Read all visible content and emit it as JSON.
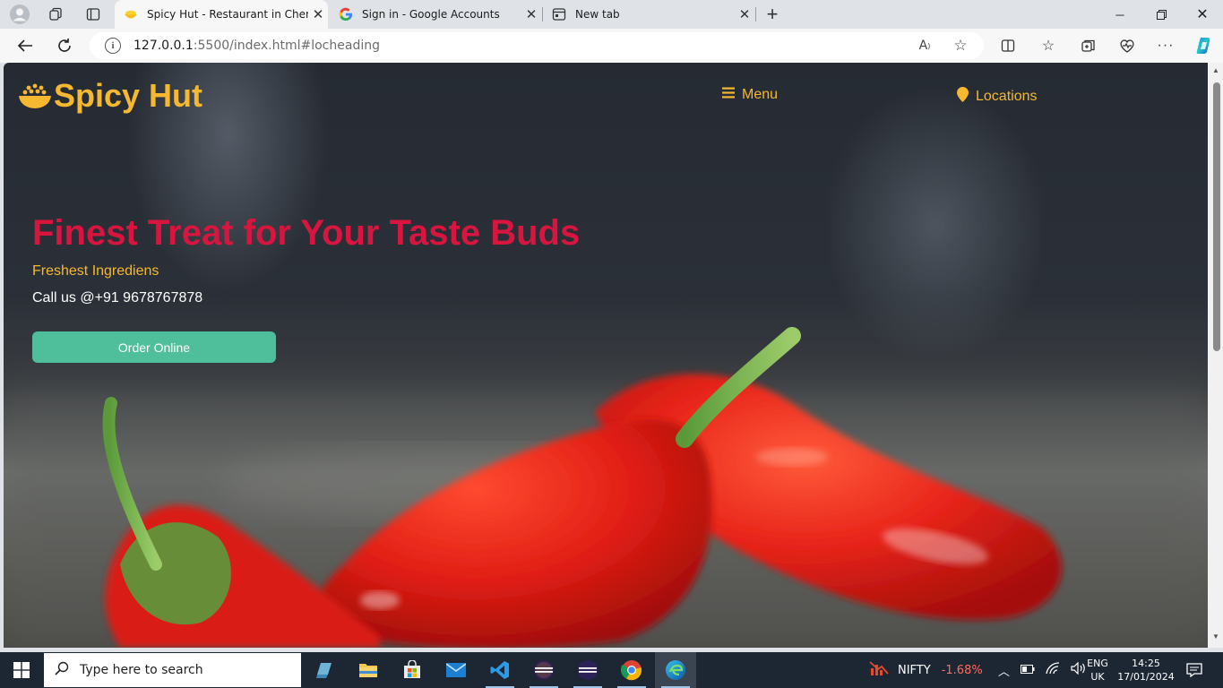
{
  "browser": {
    "tabs": [
      {
        "title": "Spicy Hut - Restaurant in Chenna",
        "icon": "rice-bowl-icon",
        "active": true
      },
      {
        "title": "Sign in - Google Accounts",
        "icon": "google-icon",
        "active": false
      },
      {
        "title": "New tab",
        "icon": "new-tab-icon",
        "active": false
      }
    ],
    "url_host": "127.0.0.1",
    "url_path": ":5500/index.html#locheading"
  },
  "site": {
    "brand": "Spicy Hut",
    "nav": {
      "menu_label": "Menu",
      "locations_label": "Locations"
    },
    "hero": {
      "headline": "Finest Treat for Your Taste Buds",
      "subtitle": "Freshest Ingrediens",
      "call": "Call us @+91 9678767878",
      "order_button": "Order Online"
    },
    "colors": {
      "brand": "#f6b830",
      "headline": "#d7153f",
      "button": "#4fbf9b"
    }
  },
  "taskbar": {
    "search_placeholder": "Type here to search",
    "stock_name": "NIFTY",
    "stock_change": "-1.68%",
    "lang_top": "ENG",
    "lang_bottom": "UK",
    "time": "14:25",
    "date": "17/01/2024"
  }
}
